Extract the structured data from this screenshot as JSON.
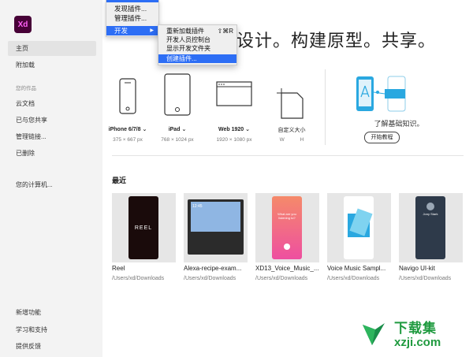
{
  "app": {
    "logo": "Xd"
  },
  "sidebar": {
    "items": [
      {
        "label": "主页"
      },
      {
        "label": "附加载"
      },
      {
        "label": "云文档"
      },
      {
        "label": "已与您共享"
      },
      {
        "label": "管理链接..."
      },
      {
        "label": "已删除"
      },
      {
        "label": "您的计算机..."
      }
    ],
    "section_label": "您的作品",
    "bottom": [
      {
        "label": "新增功能"
      },
      {
        "label": "学习和支持"
      },
      {
        "label": "提供反馈"
      }
    ]
  },
  "headline": "设计。构建原型。共享。",
  "presets": [
    {
      "label": "iPhone 6/7/8",
      "dims": "375 × 667 px",
      "icon": "phone-icon"
    },
    {
      "label": "iPad",
      "dims": "768 × 1024 px",
      "icon": "tablet-icon"
    },
    {
      "label": "Web 1920",
      "dims": "1920 × 1080 px",
      "icon": "browser-icon"
    },
    {
      "label": "自定义大小",
      "w_label": "W",
      "h_label": "H",
      "icon": "custom-size-icon"
    }
  ],
  "learn": {
    "title": "了解基础知识。",
    "button": "开始教程"
  },
  "recent": {
    "heading": "最近",
    "cards": [
      {
        "title": "Reel",
        "path": "/Users/xd/Downloads",
        "screen_text": "REEL",
        "color": "#1a0b0b"
      },
      {
        "title": "Alexa-recipe-exam...",
        "path": "/Users/xd/Downloads",
        "screen_text": "12:45",
        "color": "#2b2b2b"
      },
      {
        "title": "XD13_Voice_Music_...",
        "path": "/Users/xd/Downloads",
        "screen_text": "What are you listening to?",
        "color": "#f06a8a"
      },
      {
        "title": "Voice Music Sampl...",
        "path": "/Users/xd/Downloads",
        "screen_text": "",
        "color": "#ffffff"
      },
      {
        "title": "Navigo UI-kit",
        "path": "/Users/xd/Downloads",
        "screen_text": "Jony Stark",
        "color": "#2e3a4a"
      }
    ]
  },
  "menu": {
    "items": [
      {
        "label": "发现插件..."
      },
      {
        "label": "管理插件..."
      }
    ],
    "selected": {
      "label": "开发",
      "arrow": "▶"
    },
    "submenu": [
      {
        "label": "重新加载插件",
        "shortcut": "⇧⌘R"
      },
      {
        "label": "开发人员控制台"
      },
      {
        "label": "显示开发文件夹"
      },
      {
        "label": "创建插件..."
      }
    ]
  },
  "watermark": {
    "text_cn": "下载集",
    "text_url": "xzji.com"
  },
  "colors": {
    "accent": "#2d6ef5",
    "logo_bg": "#470137",
    "logo_fg": "#ff61f6",
    "learn_blue": "#2aa8e0"
  }
}
